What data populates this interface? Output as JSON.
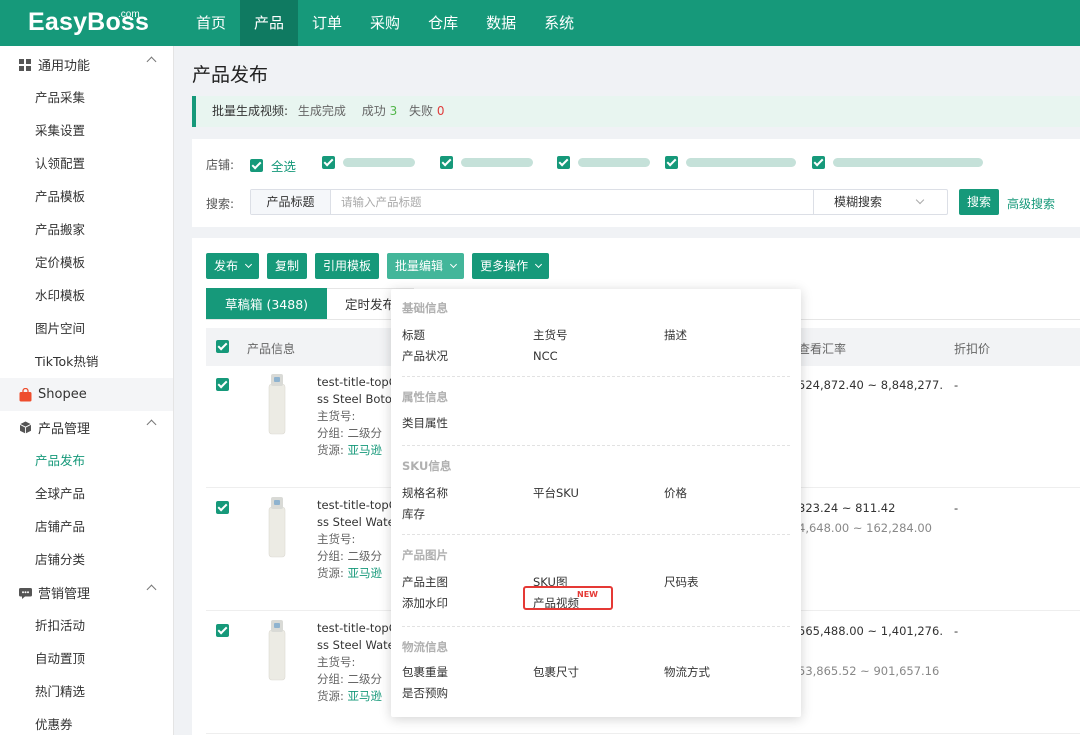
{
  "brand": {
    "logo": "EasyBoss",
    "logo_suffix": ".com"
  },
  "nav": {
    "items": [
      "首页",
      "产品",
      "订单",
      "采购",
      "仓库",
      "数据",
      "系统"
    ],
    "active_index": 1
  },
  "sidebar": {
    "groups": [
      {
        "label": "通用功能",
        "icon": "grid-icon",
        "items": [
          "产品采集",
          "采集设置",
          "认领配置",
          "产品模板",
          "产品搬家",
          "定价模板",
          "水印模板",
          "图片空间",
          "TikTok热销"
        ]
      },
      {
        "label": "Shopee",
        "icon": "shopee-bag-icon",
        "items": []
      },
      {
        "label": "产品管理",
        "icon": "cube-icon",
        "items": [
          "产品发布",
          "全球产品",
          "店铺产品",
          "店铺分类"
        ],
        "active_item": "产品发布"
      },
      {
        "label": "营销管理",
        "icon": "megaphone-icon",
        "items": [
          "折扣活动",
          "自动置顶",
          "热门精选",
          "优惠券"
        ]
      }
    ]
  },
  "page": {
    "title": "产品发布"
  },
  "notice": {
    "label": "批量生成视频:",
    "status": "生成完成",
    "success_label": "成功",
    "success_count": "3",
    "fail_label": "失败",
    "fail_count": "0"
  },
  "filter": {
    "shop_label": "店铺:",
    "select_all": "全选",
    "search_label": "搜索:",
    "search_type": "产品标题",
    "search_placeholder": "请输入产品标题",
    "search_mode": "模糊搜索",
    "search_button": "搜索",
    "advanced_search": "高级搜索"
  },
  "toolbar": {
    "publish": "发布",
    "copy": "复制",
    "use_template": "引用模板",
    "batch_edit": "批量编辑",
    "more": "更多操作"
  },
  "tabs": {
    "draft": "草稿箱 (3488)",
    "scheduled": "定时发布"
  },
  "table": {
    "headers": {
      "product_info": "产品信息",
      "rate": "查看汇率",
      "discount": "折扣价"
    },
    "rows": [
      {
        "title_line1": "test-title-topC",
        "title_line2": "ss Steel Botol",
        "sku_label": "主货号:",
        "group_label": "分组:",
        "group_value": "二级分",
        "source_label": "货源:",
        "source_value": "亚马逊",
        "price1": "524,872.40 ~ 8,848,277.",
        "price2": "",
        "discount": "-"
      },
      {
        "title_line1": "test-title-topC",
        "title_line2": "ss Steel Water",
        "sku_label": "主货号:",
        "group_label": "分组:",
        "group_value": "二级分",
        "source_label": "货源:",
        "source_value": "亚马逊",
        "price1": "323.24 ~ 811.42",
        "price2": "4,648.00 ~ 162,284.00",
        "discount": "-"
      },
      {
        "title_line1": "test-title-topC",
        "title_line2": "ss Steel Water",
        "sku_label": "主货号:",
        "group_label": "分组:",
        "group_value": "二级分",
        "source_label": "货源:",
        "source_value": "亚马逊",
        "price1": "565,488.00 ~ 1,401,276.",
        "price2": "53,865.52 ~ 901,657.16",
        "discount": "-"
      }
    ]
  },
  "batch_menu": {
    "sections": [
      {
        "title": "基础信息",
        "items": [
          "标题",
          "主货号",
          "描述",
          "产品状况",
          "NCC"
        ]
      },
      {
        "title": "属性信息",
        "items": [
          "类目属性"
        ]
      },
      {
        "title": "SKU信息",
        "items": [
          "规格名称",
          "平台SKU",
          "价格",
          "库存"
        ]
      },
      {
        "title": "产品图片",
        "items": [
          "产品主图",
          "SKU图",
          "尺码表",
          "添加水印",
          "产品视频"
        ],
        "new_badge": "NEW"
      },
      {
        "title": "物流信息",
        "items": [
          "包裹重量",
          "包裹尺寸",
          "物流方式",
          "是否预购"
        ]
      }
    ]
  },
  "colors": {
    "brand": "#16997a",
    "nav_active": "#0f7a61",
    "success": "#52b64a",
    "danger": "#e03c3c",
    "highlight": "#e53935"
  }
}
